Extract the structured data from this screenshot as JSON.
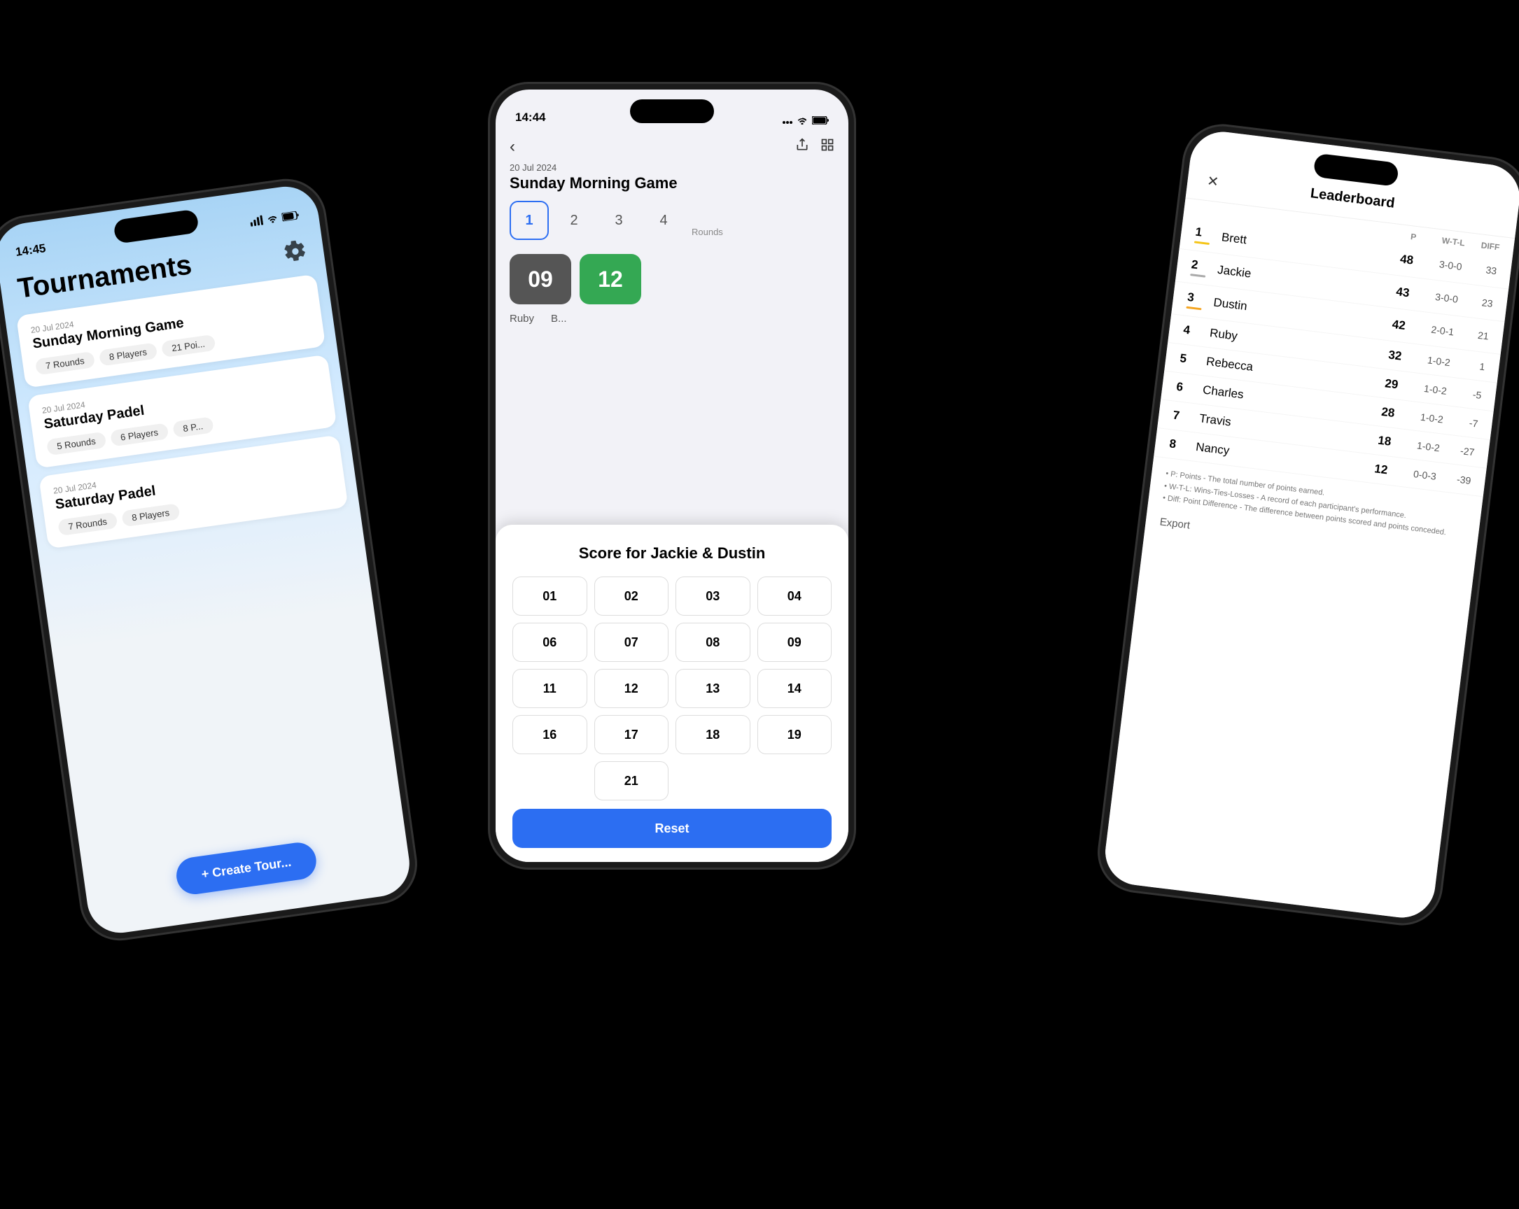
{
  "phone1": {
    "time": "14:45",
    "title": "Tournaments",
    "tournaments": [
      {
        "date": "20 Jul 2024",
        "name": "Sunday Morning Game",
        "tags": [
          "7 Rounds",
          "8 Players",
          "21 Poi..."
        ]
      },
      {
        "date": "20 Jul 2024",
        "name": "Saturday Padel",
        "tags": [
          "5 Rounds",
          "6 Players",
          "8 P..."
        ]
      },
      {
        "date": "20 Jul 2024",
        "name": "Saturday Padel",
        "tags": [
          "7 Rounds",
          "8 Players"
        ]
      }
    ],
    "createButton": "+ Create Tour..."
  },
  "phone2": {
    "time": "14:44",
    "gameDate": "20 Jul 2024",
    "gameName": "Sunday Morning Game",
    "rounds": [
      "1",
      "2",
      "3",
      "4"
    ],
    "roundsLabel": "Rounds",
    "activeRound": 0,
    "scores": [
      {
        "value": "09",
        "style": "dark"
      },
      {
        "value": "12",
        "style": "green"
      }
    ],
    "players": [
      "Ruby",
      "B..."
    ],
    "modalTitle": "Score for  Jackie & Dustin",
    "scoreButtons": [
      "01",
      "02",
      "03",
      "04",
      "06",
      "07",
      "08",
      "09",
      "11",
      "12",
      "13",
      "14",
      "16",
      "17",
      "18",
      "19",
      "21"
    ],
    "resetLabel": "Reset"
  },
  "phone3": {
    "title": "Leaderboard",
    "colHeaders": {
      "p": "P",
      "wtl": "W-T-L",
      "diff": "DIFF"
    },
    "players": [
      {
        "rank": 1,
        "name": "Brett",
        "barColor": "#f5c518",
        "p": 48,
        "wtl": "3-0-0",
        "diff": 33
      },
      {
        "rank": 2,
        "name": "Jackie",
        "barColor": "#aaa",
        "p": 43,
        "wtl": "3-0-0",
        "diff": 23
      },
      {
        "rank": 3,
        "name": "Dustin",
        "barColor": "#f5a623",
        "p": 42,
        "wtl": "2-0-1",
        "diff": 21
      },
      {
        "rank": 4,
        "name": "Ruby",
        "p": 32,
        "wtl": "1-0-2",
        "diff": 1
      },
      {
        "rank": 5,
        "name": "Rebecca",
        "p": 29,
        "wtl": "1-0-2",
        "diff": -5
      },
      {
        "rank": 6,
        "name": "Charles",
        "p": 28,
        "wtl": "1-0-2",
        "diff": -7
      },
      {
        "rank": 7,
        "name": "Travis",
        "p": 18,
        "wtl": "1-0-2",
        "diff": -27
      },
      {
        "rank": 8,
        "name": "Nancy",
        "p": 12,
        "wtl": "0-0-3",
        "diff": -39
      }
    ],
    "footer": [
      "• P: Points - The total number of points earned.",
      "• W-T-L: Wins-Ties-Losses - A record of each participant's performance.",
      "• Diff: Point Difference - The difference between points scored and points conceded."
    ],
    "exportLabel": "Export"
  }
}
